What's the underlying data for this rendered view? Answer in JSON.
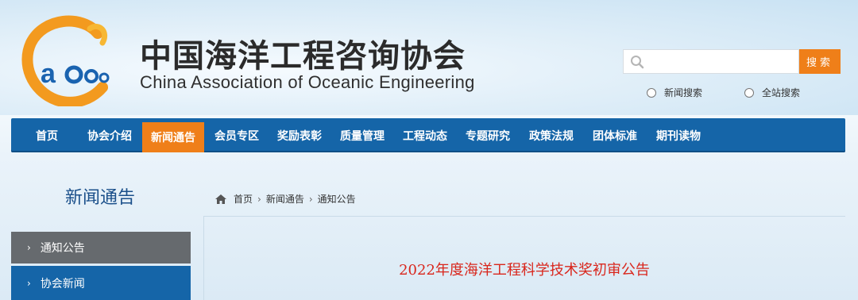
{
  "header": {
    "title_cn": "中国海洋工程咨询协会",
    "title_en": "China Association of Oceanic Engineering",
    "logo_icon": "caoe-logo-icon"
  },
  "search": {
    "placeholder": "",
    "button_label": "搜索",
    "scope_options": [
      "新闻搜索",
      "全站搜索"
    ]
  },
  "nav": {
    "items": [
      "首页",
      "协会介绍",
      "新闻通告",
      "会员专区",
      "奖励表彰",
      "质量管理",
      "工程动态",
      "专题研究",
      "政策法规",
      "团体标准",
      "期刊读物"
    ],
    "active": "新闻通告"
  },
  "sidebar": {
    "title": "新闻通告",
    "items": [
      {
        "label": "通知公告",
        "active": true
      },
      {
        "label": "协会新闻",
        "active": false
      }
    ]
  },
  "breadcrumb": {
    "items": [
      "首页",
      "新闻通告",
      "通知公告"
    ]
  },
  "article": {
    "title": "2022年度海洋工程科学技术奖初审公告"
  },
  "colors": {
    "nav_bg": "#1565a8",
    "accent": "#ef7f19",
    "title_red": "#d9261c",
    "sidebar_active": "#666a6e"
  }
}
